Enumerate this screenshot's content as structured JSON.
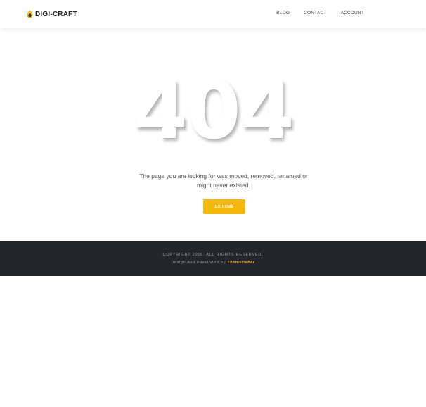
{
  "header": {
    "logo_text": "DIGI-CRAFT",
    "logo_icon": "flame-drop-icon",
    "nav": [
      {
        "label": "BLOG"
      },
      {
        "label": "CONTACT"
      },
      {
        "label": "ACCOUNT"
      }
    ]
  },
  "error": {
    "code": "404",
    "message_line1": "The page you are looking for was moved, removed, renamed or",
    "message_line2": "might never existed.",
    "button_label": "GO HOME"
  },
  "footer": {
    "copyright": "COPYRIGHT 2016. ALL RIGHTS RESERVED.",
    "credit_prefix": "Design And Developed By",
    "credit_link": "Themefisher"
  },
  "colors": {
    "accent": "#f5b80b",
    "footer_bg": "#25252c"
  }
}
